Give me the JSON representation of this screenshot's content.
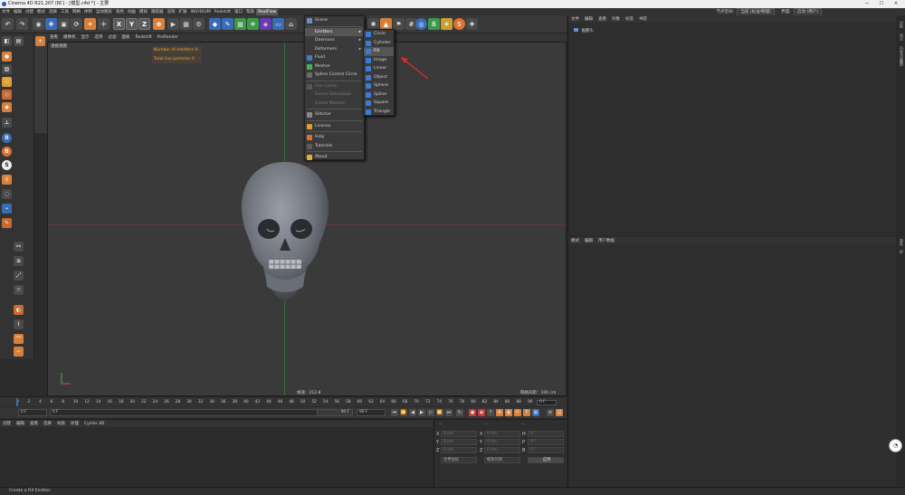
{
  "window": {
    "title": "Cinema 4D R21.207 (RC) - [模型.c4d *] - 主要",
    "controls": [
      "—",
      "☐",
      "✕"
    ]
  },
  "menubar": {
    "items": [
      "文件",
      "编辑",
      "创建",
      "模式",
      "选择",
      "工具",
      "网格",
      "体积",
      "运动图形",
      "角色",
      "动画",
      "模拟",
      "跟踪器",
      "渲染",
      "扩展",
      "INSYDIUM",
      "Redshift",
      "窗口",
      "帮助",
      "RealFlow"
    ],
    "active_index": 19,
    "layout_label": "节点空间:",
    "layout_value": "当前 (标准/物理)",
    "interface_label": "界面:",
    "interface_value": "启动 (用户)"
  },
  "toolbar": {
    "axis_buttons": [
      "X",
      "Y",
      "Z"
    ]
  },
  "viewport": {
    "menus": [
      "查看",
      "摄像机",
      "显示",
      "选项",
      "过滤",
      "面板",
      "Redshift",
      "ProRender"
    ],
    "label": "透视视图",
    "hud": [
      "Number of emitters 0",
      "Total live particles 0"
    ],
    "status": "帧速：212.8",
    "grid_spacing": "网格间距：100 cm"
  },
  "realflow_menu": {
    "items": [
      {
        "label": "Scene",
        "state": "normal",
        "icon": "scene-icon",
        "color": "#6a8fc4"
      },
      {
        "sep": true
      },
      {
        "label": "Emitters",
        "state": "highlight",
        "arrow": "▸",
        "icon": "",
        "color": ""
      },
      {
        "label": "Daemons",
        "state": "normal",
        "arrow": "▸",
        "icon": "",
        "color": ""
      },
      {
        "label": "Deformers",
        "state": "normal",
        "arrow": "▸",
        "icon": "",
        "color": ""
      },
      {
        "label": "Fluid",
        "state": "normal",
        "icon": "fluid-icon",
        "color": "#3a7bd5"
      },
      {
        "label": "Mesher",
        "state": "normal",
        "icon": "mesher-icon",
        "color": "#4caf50"
      },
      {
        "label": "Spline Control Circle",
        "state": "normal",
        "icon": "spline-icon",
        "color": "#6a6a6a"
      },
      {
        "sep": true
      },
      {
        "label": "Use Cache",
        "state": "disabled",
        "icon": "cache-icon",
        "color": "#555555"
      },
      {
        "label": "Cache Simulation",
        "state": "disabled",
        "icon": "",
        "color": ""
      },
      {
        "label": "Cache Meshes",
        "state": "disabled",
        "icon": "",
        "color": ""
      },
      {
        "sep": true
      },
      {
        "label": "Stitcher",
        "state": "normal",
        "icon": "stitcher-icon",
        "color": "#8a8a8a"
      },
      {
        "sep": true
      },
      {
        "label": "License",
        "state": "normal",
        "icon": "license-icon",
        "color": "#e0a030"
      },
      {
        "sep": true
      },
      {
        "label": "Help",
        "state": "normal",
        "icon": "help-icon",
        "color": "#e07030"
      },
      {
        "label": "Tutorials",
        "state": "normal",
        "icon": "tutorials-icon",
        "color": "#5a5a5a"
      },
      {
        "sep": true
      },
      {
        "label": "About",
        "state": "normal",
        "icon": "about-icon",
        "color": "#e0b030"
      }
    ]
  },
  "emitters_submenu": {
    "items": [
      "Circle",
      "Cylinder",
      "Fill",
      "Image",
      "Linear",
      "Object",
      "Sphere",
      "Spline",
      "Square",
      "Triangle"
    ],
    "highlight_index": 2
  },
  "object_manager": {
    "menus": [
      "文件",
      "编辑",
      "查看",
      "对象",
      "标签",
      "书签"
    ],
    "row": "骷髅头"
  },
  "attribute_manager": {
    "menus": [
      "模式",
      "编辑",
      "用户数据"
    ]
  },
  "right_tabs": [
    "对象",
    "场次",
    "内容浏览器",
    "构造"
  ],
  "right_tabs_lower": [
    "属性",
    "层"
  ],
  "timeline": {
    "ticks": [
      "0",
      "2",
      "4",
      "6",
      "8",
      "10",
      "12",
      "14",
      "16",
      "18",
      "20",
      "22",
      "24",
      "26",
      "28",
      "30",
      "32",
      "34",
      "36",
      "38",
      "40",
      "42",
      "44",
      "46",
      "48",
      "50",
      "52",
      "54",
      "56",
      "58",
      "60",
      "62",
      "64",
      "66",
      "68",
      "70",
      "72",
      "74",
      "76",
      "78",
      "80",
      "82",
      "84",
      "86",
      "88",
      "90"
    ],
    "current": "0 F",
    "end_field": "90 F"
  },
  "transport": {
    "start": "0 F",
    "current": "0 F",
    "range_end": "90 F",
    "end": "90 F"
  },
  "material_panel": {
    "menus": [
      "创建",
      "编辑",
      "查看",
      "选择",
      "材质",
      "纹理",
      "Cycles 4D"
    ]
  },
  "coord_panel": {
    "header": [
      "--",
      "--",
      "--"
    ],
    "rows": [
      {
        "a": "X",
        "av": "0 cm",
        "b": "X",
        "bv": "0 cm",
        "c": "H",
        "cv": "0 °"
      },
      {
        "a": "Y",
        "av": "0 cm",
        "b": "Y",
        "bv": "0 cm",
        "c": "P",
        "cv": "0 °"
      },
      {
        "a": "Z",
        "av": "0 cm",
        "b": "Z",
        "bv": "0 cm",
        "c": "B",
        "cv": "0 °"
      }
    ],
    "mode1": "世界坐标",
    "mode2": "缩放比例",
    "apply": "应用"
  },
  "statusbar": {
    "text": "Create a Fill Emitter"
  },
  "colors": {
    "accent": "#d8803a",
    "hud_text": "#e8a23a",
    "arrow": "#e0282a"
  }
}
